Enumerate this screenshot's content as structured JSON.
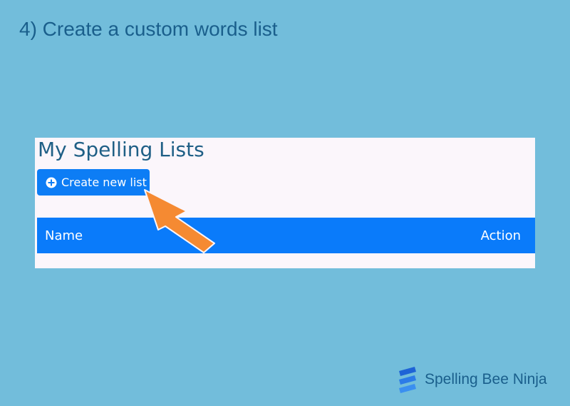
{
  "slide": {
    "step_title": "4) Create a custom words list"
  },
  "app": {
    "heading": "My Spelling Lists",
    "create_button": {
      "icon": "plus-circle-icon",
      "label": "Create new list"
    },
    "table": {
      "columns": [
        "Name",
        "Action"
      ]
    }
  },
  "annotation": {
    "icon": "arrow-pointer-icon",
    "color": "#f58a32"
  },
  "brand": {
    "logo_icon": "spelling-bee-ninja-logo-icon",
    "name": "Spelling Bee Ninja"
  },
  "colors": {
    "background": "#72bddb",
    "primary": "#0a7bfa",
    "title_text": "#1a5f8c",
    "panel": "#fbf6fb"
  }
}
